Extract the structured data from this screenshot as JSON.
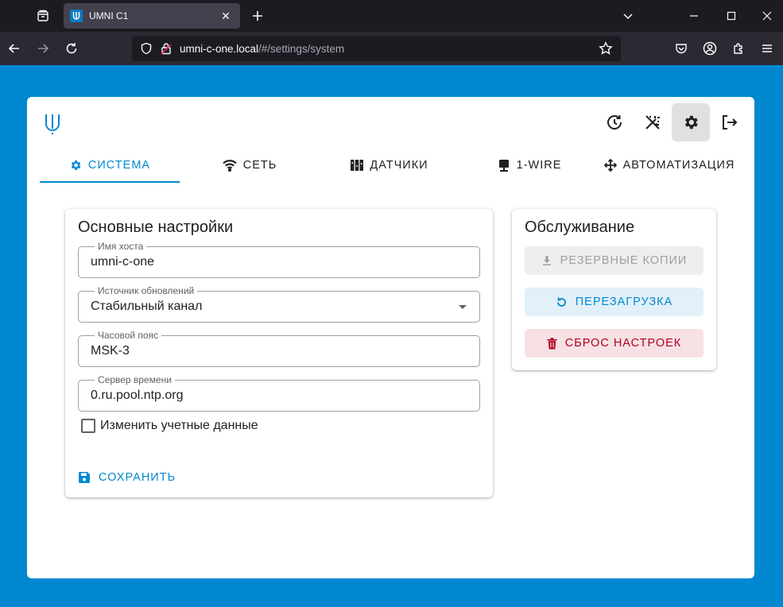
{
  "browser": {
    "tab_title": "UMNI C1",
    "tab_close": "✕",
    "new_tab": "+",
    "url_host": "umni-c-one.local",
    "url_path": "/#/settings/system"
  },
  "app": {
    "tabs": [
      {
        "label": "СИСТЕМА",
        "icon": "gear-icon",
        "active": true
      },
      {
        "label": "СЕТЬ",
        "icon": "wifi-icon",
        "active": false
      },
      {
        "label": "ДАТЧИКИ",
        "icon": "sensors-icon",
        "active": false
      },
      {
        "label": "1-WIRE",
        "icon": "one-wire-icon",
        "active": false
      },
      {
        "label": "АВТОМАТИЗАЦИЯ",
        "icon": "automation-icon",
        "active": false
      }
    ]
  },
  "settings": {
    "title": "Основные настройки",
    "hostname": {
      "label": "Имя хоста",
      "value": "umni-c-one"
    },
    "update_source": {
      "label": "Источник обновлений",
      "value": "Стабильный канал"
    },
    "timezone": {
      "label": "Часовой пояс",
      "value": "MSK-3"
    },
    "time_server": {
      "label": "Сервер времени",
      "value": "0.ru.pool.ntp.org"
    },
    "change_credentials": {
      "label": "Изменить учетные данные",
      "checked": false
    },
    "save_label": "СОХРАНИТЬ"
  },
  "maintenance": {
    "title": "Обслуживание",
    "backup_label": "РЕЗЕРВНЫЕ КОПИИ",
    "reboot_label": "ПЕРЕЗАГРУЗКА",
    "reset_label": "СБРОС НАСТРОЕК"
  },
  "colors": {
    "accent": "#0288d1",
    "danger": "#b0001f",
    "page_background": "#0288d1"
  }
}
